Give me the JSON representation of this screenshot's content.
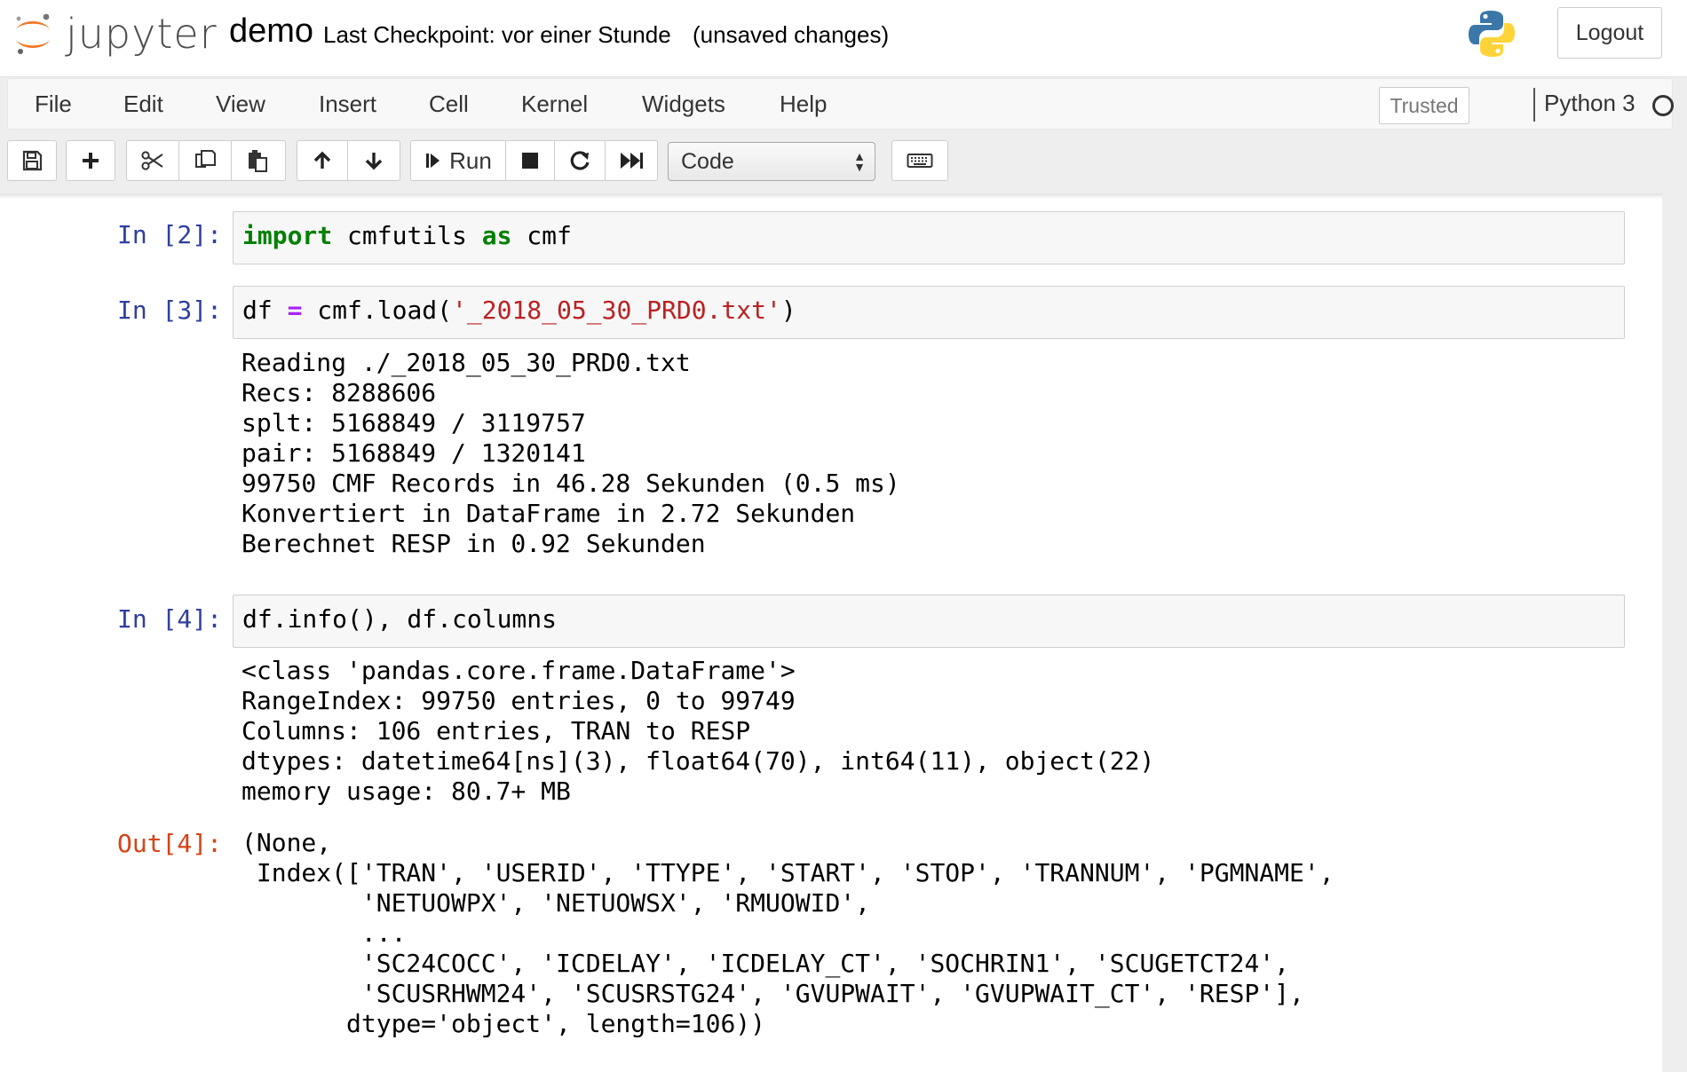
{
  "header": {
    "logo_text": "jupyter",
    "notebook_name": "demo",
    "checkpoint": "Last Checkpoint: vor einer Stunde",
    "autosave_status": "(unsaved changes)",
    "logout_label": "Logout"
  },
  "menubar": {
    "items": [
      "File",
      "Edit",
      "View",
      "Insert",
      "Cell",
      "Kernel",
      "Widgets",
      "Help"
    ],
    "trusted_label": "Trusted",
    "kernel_name": "Python 3"
  },
  "toolbar": {
    "run_label": "Run",
    "cell_type": "Code"
  },
  "cells": [
    {
      "prompt": "In [2]:",
      "input": [
        {
          "t": "import",
          "c": "kw"
        },
        {
          "t": " cmfutils ",
          "c": ""
        },
        {
          "t": "as",
          "c": "kw"
        },
        {
          "t": " cmf",
          "c": ""
        }
      ],
      "output": []
    },
    {
      "prompt": "In [3]:",
      "input": [
        {
          "t": "df ",
          "c": ""
        },
        {
          "t": "=",
          "c": "op"
        },
        {
          "t": " cmf.load(",
          "c": ""
        },
        {
          "t": "'_2018_05_30_PRD0.txt'",
          "c": "str"
        },
        {
          "t": ")",
          "c": ""
        }
      ],
      "output": [
        "Reading ./_2018_05_30_PRD0.txt",
        "Recs: 8288606",
        "splt: 5168849 / 3119757",
        "pair: 5168849 / 1320141",
        "99750 CMF Records in 46.28 Sekunden (0.5 ms)",
        "Konvertiert in DataFrame in 2.72 Sekunden",
        "Berechnet RESP in 0.92 Sekunden"
      ]
    },
    {
      "prompt": "In [4]:",
      "input": [
        {
          "t": "df.info(), df.columns",
          "c": ""
        }
      ],
      "output": [
        "<class 'pandas.core.frame.DataFrame'>",
        "RangeIndex: 99750 entries, 0 to 99749",
        "Columns: 106 entries, TRAN to RESP",
        "dtypes: datetime64[ns](3), float64(70), int64(11), object(22)",
        "memory usage: 80.7+ MB"
      ],
      "out_prompt": "Out[4]:",
      "result": [
        "(None,",
        " Index(['TRAN', 'USERID', 'TTYPE', 'START', 'STOP', 'TRANNUM', 'PGMNAME',",
        "        'NETUOWPX', 'NETUOWSX', 'RMUOWID',",
        "        ...",
        "        'SC24COCC', 'ICDELAY', 'ICDELAY_CT', 'SOCHRIN1', 'SCUGETCT24',",
        "        'SCUSRHWM24', 'SCUSRSTG24', 'GVUPWAIT', 'GVUPWAIT_CT', 'RESP'],",
        "       dtype='object', length=106))"
      ]
    }
  ],
  "colors": {
    "prompt_in": "#303f9f",
    "prompt_out": "#d84315",
    "keyword": "#008000",
    "string": "#ba2121",
    "operator": "#aa22ff"
  }
}
